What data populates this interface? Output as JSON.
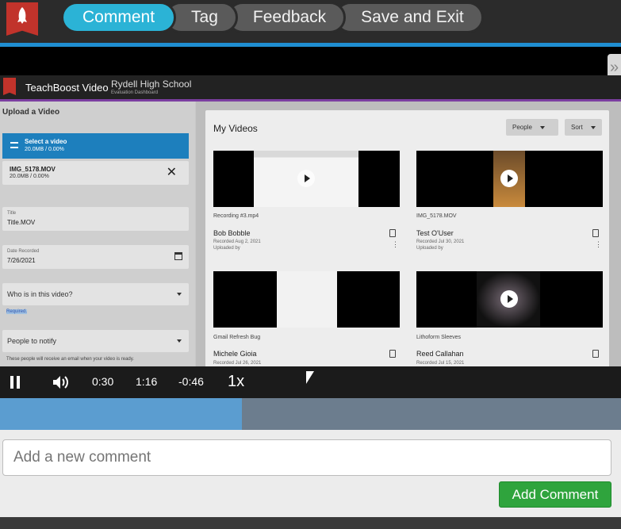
{
  "toolbar": {
    "tabs": [
      {
        "label": "Comment",
        "active": true
      },
      {
        "label": "Tag"
      },
      {
        "label": "Feedback"
      },
      {
        "label": "Save and Exit"
      }
    ],
    "logo_icon": "rocket-icon"
  },
  "side_collapse_label": "»",
  "video_frame": {
    "app_title": "TeachBoost Video",
    "school": "Rydell High School",
    "school_sub": "Evaluation Dashboard",
    "upload": {
      "heading": "Upload a Video",
      "select_label": "Select a video",
      "select_size": "20.0MB / 0.00%",
      "file_name": "IMG_5178.MOV",
      "file_size": "20.0MB / 0.00%",
      "title_label": "Title",
      "title_value": "Title.MOV",
      "date_label": "Date Recorded",
      "date_value": "7/26/2021",
      "who_placeholder": "Who is in this video?",
      "required_text": "Required.",
      "notify_placeholder": "People to notify",
      "notify_hint": "These people will receive an email when your video is ready."
    },
    "my_videos": {
      "heading": "My Videos",
      "people_filter": "People",
      "sort_filter": "Sort",
      "videos": [
        {
          "file": "Recording #3.mp4",
          "person": "Bob Bobble",
          "recorded": "Recorded Aug 2, 2021",
          "uploaded": "Uploaded by"
        },
        {
          "file": "IMG_5178.MOV",
          "person": "Test O'User",
          "recorded": "Recorded Jul 30, 2021",
          "uploaded": "Uploaded by"
        },
        {
          "file": "Gmail Refresh Bug",
          "person": "Michele Gioia",
          "recorded": "Recorded Jul 26, 2021",
          "uploaded": ""
        },
        {
          "file": "Lithoform Sleeves",
          "person": "Reed Callahan",
          "recorded": "Recorded Jul 15, 2021",
          "uploaded": ""
        }
      ]
    }
  },
  "player": {
    "current_time": "0:30",
    "duration": "1:16",
    "remaining": "-0:46",
    "speed": "1x",
    "progress_fraction": 0.39
  },
  "comment": {
    "placeholder": "Add a new comment",
    "submit_label": "Add Comment"
  },
  "colors": {
    "active_tab": "#2bb3d6",
    "accent_bar": "#1f8ed1",
    "add_button": "#2fa43d"
  }
}
